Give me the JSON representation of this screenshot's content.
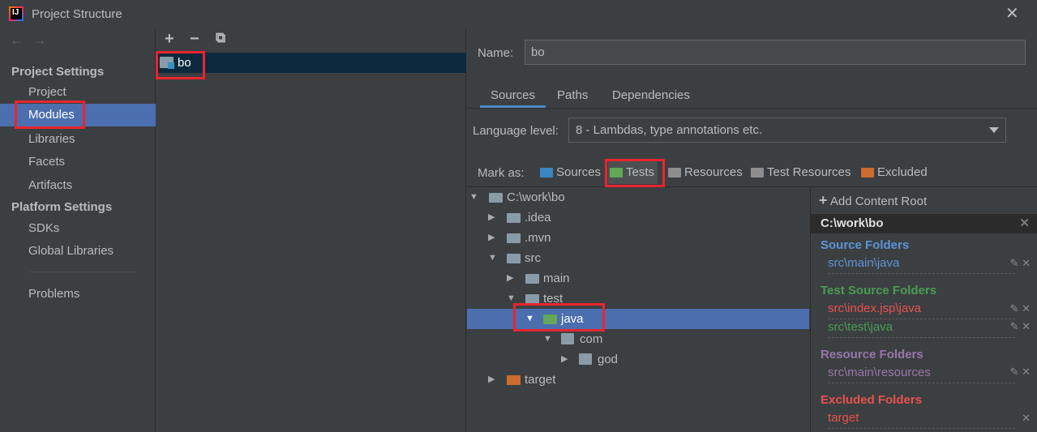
{
  "window": {
    "title": "Project Structure",
    "close": "✕"
  },
  "left_nav": {
    "arrows": "←→",
    "project_settings": "Project Settings",
    "project_items": [
      "Project",
      "Modules",
      "Libraries",
      "Facets",
      "Artifacts"
    ],
    "platform_settings": "Platform Settings",
    "platform_items": [
      "SDKs",
      "Global Libraries"
    ],
    "problems": "Problems",
    "selected": "Modules"
  },
  "middle": {
    "toolbar": {
      "add": "+",
      "remove": "−",
      "copy": "⧉"
    },
    "module": "bo"
  },
  "module_settings": {
    "name_label": "Name:",
    "name_value": "bo",
    "tabs": [
      "Sources",
      "Paths",
      "Dependencies"
    ],
    "active_tab": "Sources",
    "language_level_label": "Language level:",
    "language_level_value": "8 - Lambdas, type annotations etc.",
    "mark_as_label": "Mark as:",
    "mark_as": [
      {
        "label": "Sources",
        "color": "#3a87c4"
      },
      {
        "label": "Tests",
        "color": "#62a857"
      },
      {
        "label": "Resources",
        "color": "#8d8d8d"
      },
      {
        "label": "Test Resources",
        "color": "#8d8d8d"
      },
      {
        "label": "Excluded",
        "color": "#cc6c2e"
      }
    ]
  },
  "tree": [
    {
      "label": "C:\\work\\bo",
      "toggle": "▼",
      "color": "#8a9ba8"
    },
    {
      "label": ".idea",
      "toggle": "▶",
      "color": "#8a9ba8"
    },
    {
      "label": ".mvn",
      "toggle": "▶",
      "color": "#8a9ba8"
    },
    {
      "label": "src",
      "toggle": "▼",
      "color": "#8a9ba8"
    },
    {
      "label": "main",
      "toggle": "▶",
      "color": "#8a9ba8"
    },
    {
      "label": "test",
      "toggle": "▼",
      "color": "#8a9ba8"
    },
    {
      "label": "java",
      "toggle": "▼",
      "color": "#62a857"
    },
    {
      "label": "com",
      "toggle": "▼",
      "color": "#8a9ba8"
    },
    {
      "label": "god",
      "toggle": "▶",
      "color": "#8a9ba8"
    },
    {
      "label": "target",
      "toggle": "▶",
      "color": "#cc6c2e"
    }
  ],
  "content_roots": {
    "add": "Add Content Root",
    "root": "C:\\work\\bo",
    "source_folders_title": "Source Folders",
    "source_folders": [
      "src\\main\\java"
    ],
    "test_source_folders_title": "Test Source Folders",
    "test_source_folders": [
      "src\\index.jsp\\java",
      "src\\test\\java"
    ],
    "resource_folders_title": "Resource Folders",
    "resource_folders": [
      "src\\main\\resources"
    ],
    "excluded_folders_title": "Excluded Folders",
    "excluded_folders": [
      "target"
    ],
    "colors": {
      "source": "#5c94d6",
      "test": "#499c54",
      "test_bad": "#e8514f",
      "resource": "#9876aa",
      "excluded": "#e8514f"
    }
  },
  "highlight_color": "#e8252e"
}
